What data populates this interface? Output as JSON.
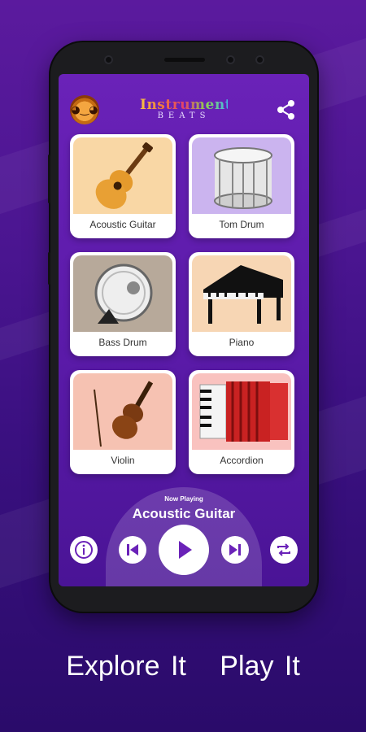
{
  "app": {
    "logo_line1": "Instrument",
    "logo_line2": "BEATS"
  },
  "instruments": [
    {
      "label": "Acoustic Guitar",
      "bg": "#f9d7a5"
    },
    {
      "label": "Tom Drum",
      "bg": "#cbb4ef"
    },
    {
      "label": "Bass Drum",
      "bg": "#b7a99a"
    },
    {
      "label": "Piano",
      "bg": "#f7d6b4"
    },
    {
      "label": "Violin",
      "bg": "#f6c2b2"
    },
    {
      "label": "Accordion",
      "bg": "#f9c2bf"
    }
  ],
  "player": {
    "now_playing_label": "Now Playing",
    "track": "Acoustic Guitar"
  },
  "tagline": {
    "left": "Explore It",
    "right": "Play It"
  },
  "icons": {
    "share": "share-icon",
    "info": "info-icon",
    "previous": "previous-icon",
    "play": "play-icon",
    "next": "next-icon",
    "repeat": "repeat-icon"
  },
  "colors": {
    "accent": "#6a22b8",
    "background": "#4a1590"
  }
}
